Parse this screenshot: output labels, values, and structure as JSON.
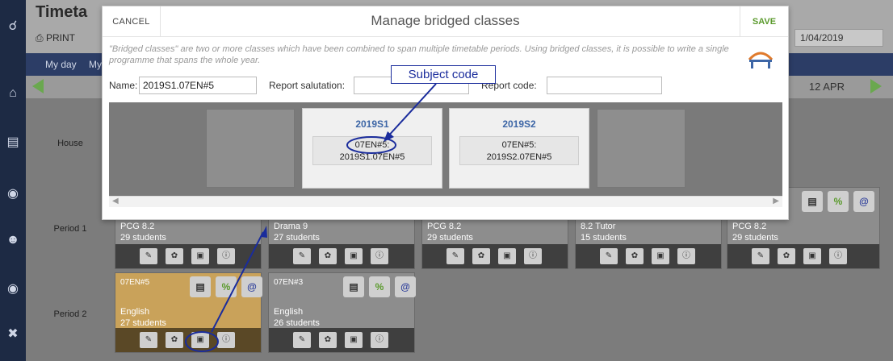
{
  "app": {
    "title": "Timeta",
    "print_label": "PRINT",
    "date_value": "1/04/2019",
    "nav": [
      "My day",
      "My"
    ],
    "date_range_end": "12 APR"
  },
  "rows": [
    {
      "label": "House"
    },
    {
      "label": "Period 1"
    },
    {
      "label": "Period 2"
    }
  ],
  "period1_cells": [
    {
      "code": "",
      "subject": "PCG 8.2",
      "students": "29 students"
    },
    {
      "code": "",
      "subject": "Drama 9",
      "students": "27 students"
    },
    {
      "code": "",
      "subject": "PCG 8.2",
      "students": "29 students"
    },
    {
      "code": "",
      "subject": "8.2 Tutor",
      "students": "15 students"
    },
    {
      "code": "",
      "subject": "PCG 8.2",
      "students": "29 students"
    }
  ],
  "period2_cells": [
    {
      "code": "07EN#5",
      "subject": "English",
      "students": "27 students"
    },
    {
      "code": "07EN#3",
      "subject": "English",
      "students": "26 students"
    }
  ],
  "modal": {
    "cancel_label": "CANCEL",
    "title": "Manage bridged classes",
    "save_label": "SAVE",
    "description": "\"Bridged classes\" are two or more classes which have been combined to span multiple timetable periods. Using bridged classes, it is possible to write a single programme that spans the whole year.",
    "name_label": "Name:",
    "name_value": "2019S1.07EN#5",
    "salutation_label": "Report salutation:",
    "salutation_value": "",
    "report_code_label": "Report code:",
    "report_code_value": "",
    "cards": [
      {
        "title": "2019S1",
        "line1": "07EN#5:",
        "line2": "2019S1.07EN#5"
      },
      {
        "title": "2019S2",
        "line1": "07EN#5:",
        "line2": "2019S2.07EN#5"
      }
    ]
  },
  "callout": {
    "label": "Subject code"
  },
  "colors": {
    "nav_bg": "#2c3d66",
    "accent_blue": "#1a2c9c",
    "save_green": "#5a9a2c",
    "english_cell": "#c9a25a",
    "period_cell": "#8d8d8d",
    "card_title": "#3d66a6"
  },
  "icons": [
    "search-icon",
    "home-icon",
    "classroom-icon",
    "globe-icon",
    "person-icon",
    "gear-icon",
    "tools-icon",
    "bridge-icon",
    "percent-icon",
    "at-icon",
    "notes-icon"
  ]
}
